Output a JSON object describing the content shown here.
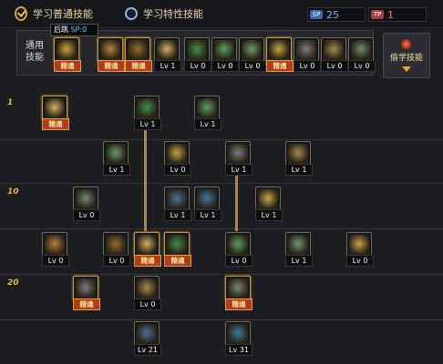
{
  "tabs": [
    {
      "label": "学习普通技能",
      "selected": true
    },
    {
      "label": "学习特性技能",
      "selected": false
    }
  ],
  "sp_counters": [
    {
      "tag": "SP",
      "value": "25",
      "color": "#72b6ff"
    },
    {
      "tag": "TP",
      "value": "1",
      "color": "#ff6b5c"
    }
  ],
  "common_skills": {
    "label": "通用\n技能",
    "items": [
      {
        "text": "精通",
        "icon": "back-jump-icon"
      },
      {
        "text": "精通",
        "icon": "leap-icon"
      },
      {
        "text": "精通",
        "icon": "rise-kick-icon"
      },
      {
        "text": "Lv 1",
        "icon": "wing-icon"
      },
      {
        "text": "Lv 0",
        "icon": "compass-icon"
      },
      {
        "text": "Lv 0",
        "icon": "burst-icon"
      },
      {
        "text": "Lv 0",
        "icon": "silhouette-icon"
      },
      {
        "text": "精通",
        "icon": "dash-icon"
      },
      {
        "text": "Lv 0",
        "icon": "shield-eye-icon"
      },
      {
        "text": "Lv 0",
        "icon": "strength-icon"
      },
      {
        "text": "Lv 0",
        "icon": "fighter-icon"
      }
    ]
  },
  "learn_button": {
    "label": "偷学技能"
  },
  "tooltip": {
    "name": "后跳",
    "sp": "SP:0"
  },
  "level_markers": [
    "1",
    "10",
    "20"
  ],
  "tree_skills": [
    {
      "text": "精通",
      "icon": "basic-mastery-icon"
    },
    {
      "text": "Lv 1",
      "icon": "blade-drop-icon"
    },
    {
      "text": "Lv 1",
      "icon": "sword-slash-icon"
    },
    {
      "text": "Lv 1",
      "icon": "running-slash-icon"
    },
    {
      "text": "Lv 0",
      "icon": "orb-throw-icon"
    },
    {
      "text": "Lv 1",
      "icon": "twin-strike-icon"
    },
    {
      "text": "Lv 1",
      "icon": "crescent-icon"
    },
    {
      "text": "Lv 0",
      "icon": "frost-cross-icon"
    },
    {
      "text": "Lv 1",
      "icon": "whirl-icon"
    },
    {
      "text": "Lv 1",
      "icon": "arc-icon"
    },
    {
      "text": "Lv 1",
      "icon": "rising-strike-icon"
    },
    {
      "text": "Lv 0",
      "icon": "swirl-icon"
    },
    {
      "text": "Lv 0",
      "icon": "fang-icon"
    },
    {
      "text": "精通",
      "icon": "green-blade-icon"
    },
    {
      "text": "精通",
      "icon": "green-rune-icon"
    },
    {
      "text": "Lv 0",
      "icon": "gold-leap-icon"
    },
    {
      "text": "Lv 1",
      "icon": "fist-icon"
    },
    {
      "text": "Lv 0",
      "icon": "spear-icon"
    },
    {
      "text": "精通",
      "icon": "flame-mastery-icon"
    },
    {
      "text": "Lv 0",
      "icon": "vortex-icon"
    },
    {
      "text": "精通",
      "icon": "frost-nova-icon"
    },
    {
      "text": "Lv 21",
      "icon": "red-blade-icon"
    },
    {
      "text": "Lv 31",
      "icon": "inferno-icon"
    }
  ]
}
